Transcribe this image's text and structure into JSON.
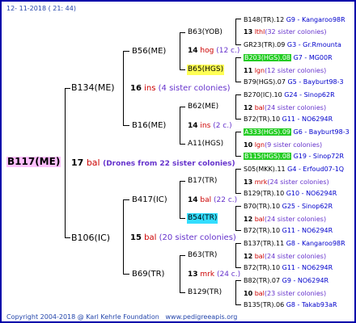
{
  "date": "12- 11-2018 ( 21: 44)",
  "footer": {
    "copyright": "Copyright 2004-2018 @ Karl Kehrle Foundation",
    "site": "www.pedigreeapis.org"
  },
  "root": {
    "name": "B117(ME)",
    "num": "17",
    "ins": "bal",
    "note": "(Drones from 22 sister colonies)"
  },
  "gen1": [
    {
      "name": "B134(ME)",
      "num": "16",
      "ins": "ins",
      "note": "(4 sister colonies)"
    },
    {
      "name": "B106(IC)",
      "num": "15",
      "ins": "bal",
      "note": "(20 sister colonies)"
    }
  ],
  "gen2": [
    {
      "name": "B56(ME)",
      "num": "14",
      "ins": "hog",
      "note": "(12 c.)"
    },
    {
      "name": "B16(ME)",
      "num": "14",
      "ins": "ins",
      "note": "(2 c.)"
    },
    {
      "name": "B417(IC)",
      "num": "14",
      "ins": "bal",
      "note": "(22 c.)"
    },
    {
      "name": "B69(TR)",
      "num": "13",
      "ins": "mrk",
      "note": "(24 c.)"
    }
  ],
  "gen3": [
    {
      "name": "B63(YOB)"
    },
    {
      "name": "B65(HGS)"
    },
    {
      "name": "B62(ME)"
    },
    {
      "name": "A11(HGS)"
    },
    {
      "name": "B17(TR)"
    },
    {
      "name": "B54(TR)"
    },
    {
      "name": "B63(TR)"
    },
    {
      "name": "B129(TR)"
    }
  ],
  "gen4": [
    {
      "a": "B148(TR).12",
      "b": "G9 - Kangaroo98R",
      "num": "13",
      "ins": "lthl",
      "note": "(32 sister colonies)",
      "c": "GR23(TR).09",
      "d": "G3 - Gr.Rmounta"
    },
    {
      "a": "B203(HGS).08",
      "b": "G7 - MG00R",
      "num": "11",
      "ins": "lgn",
      "note": "(12 sister colonies)",
      "c": "B79(HGS).07",
      "d": "G5 - Bayburt98-3"
    },
    {
      "a": "B270(IC).10",
      "b": "G24 - Sinop62R",
      "num": "12",
      "ins": "bal",
      "note": "(24 sister colonies)",
      "c": "B72(TR).10",
      "d": "G11 - NO6294R"
    },
    {
      "a": "A333(HGS).09",
      "b": "G6 - Bayburt98-3",
      "num": "10",
      "ins": "lgn",
      "note": "(9 sister colonies)",
      "c": "B115(HGS).08",
      "d": "G19 - Sinop72R"
    },
    {
      "a": "S05(MKK).11",
      "b": "G4 - Erfoud07-1Q",
      "num": "13",
      "ins": "mrk",
      "note": "(24 sister colonies)",
      "c": "B129(TR).10",
      "d": "G10 - NO6294R"
    },
    {
      "a": "B70(TR).10",
      "b": "G25 - Sinop62R",
      "num": "12",
      "ins": "bal",
      "note": "(24 sister colonies)",
      "c": "B72(TR).10",
      "d": "G11 - NO6294R"
    },
    {
      "a": "B137(TR).11",
      "b": "G8 - Kangaroo98R",
      "num": "12",
      "ins": "bal",
      "note": "(24 sister colonies)",
      "c": "B72(TR).10",
      "d": "G11 - NO6294R"
    },
    {
      "a": "B82(TR).07",
      "b": "G9 - NO6294R",
      "num": "10",
      "ins": "bal",
      "note": "(23 sister colonies)",
      "c": "B135(TR).06",
      "d": "G8 - Takab93aR"
    }
  ]
}
